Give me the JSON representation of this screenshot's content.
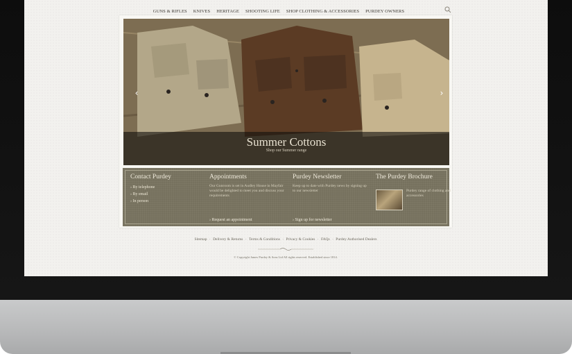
{
  "nav": {
    "items": [
      "GUNS & RIFLES",
      "KNIVES",
      "HERITAGE",
      "SHOOTING LIFE",
      "SHOP CLOTHING & ACCESSORIES",
      "PURDEY OWNERS"
    ]
  },
  "hero": {
    "title": "Summer Cottons",
    "subtitle": "Shop our Summer range"
  },
  "panel": {
    "contact": {
      "title": "Contact Purdey",
      "items": [
        "By telephone",
        "By email",
        "In person"
      ]
    },
    "appointments": {
      "title": "Appointments",
      "text": "Our Gunroom is set in Audley House in Mayfair would be delighted to meet you and discuss your requirements",
      "link": "Request an appointment"
    },
    "newsletter": {
      "title": "Purdey Newsletter",
      "text": "Keep up to date with Purdey news by signing up to our newsletter",
      "link": "Sign up for newsletter"
    },
    "brochure": {
      "title": "The Purdey Brochure",
      "text": "Purdey range of clothing and accessories"
    }
  },
  "footer": {
    "links": [
      "Sitemap",
      "Delivery & Returns",
      "Terms & Conditions",
      "Privacy & Cookies",
      "FAQs",
      "Purdey Authorised Dealers"
    ],
    "copyright": "© Copyright James Purdey & Sons Ltd All rights reserved. Established since 1814."
  },
  "icons": {
    "search": "search-icon",
    "prev": "chevron-left-icon",
    "next": "chevron-right-icon"
  }
}
